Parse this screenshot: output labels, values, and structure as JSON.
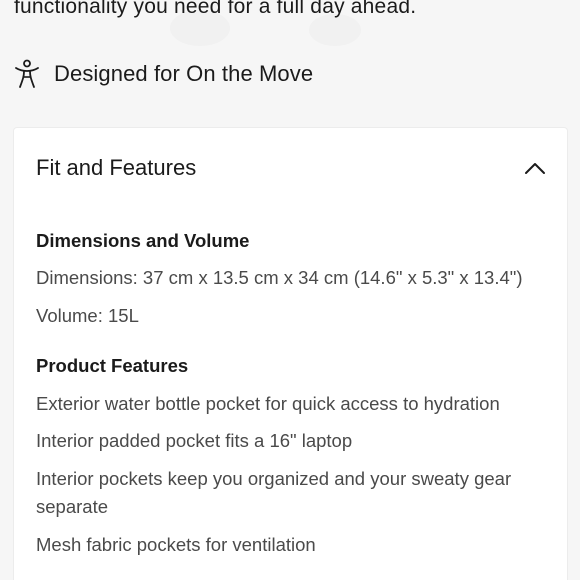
{
  "intro": {
    "text": "functionality you need for a full day ahead."
  },
  "highlight": {
    "icon": "accessibility-person-icon",
    "label": "Designed for On the Move"
  },
  "accordion": {
    "title": "Fit and Features",
    "expanded": true,
    "toggle_icon": "chevron-up-icon",
    "sections": [
      {
        "heading": "Dimensions and Volume",
        "lines": [
          "Dimensions: 37 cm x 13.5 cm x 34 cm (14.6\" x 5.3\" x 13.4\")",
          "Volume: 15L"
        ]
      },
      {
        "heading": "Product Features",
        "lines": [
          "Exterior water bottle pocket for quick access to hydration",
          "Interior padded pocket fits a 16\" laptop",
          "Interior pockets keep you organized and your sweaty gear separate",
          "Mesh fabric pockets for ventilation"
        ]
      }
    ]
  },
  "colors": {
    "page_background": "#f6f6f6",
    "card_background": "#ffffff",
    "heading_text": "#1b1b1b",
    "body_text": "#4a4a4a"
  }
}
